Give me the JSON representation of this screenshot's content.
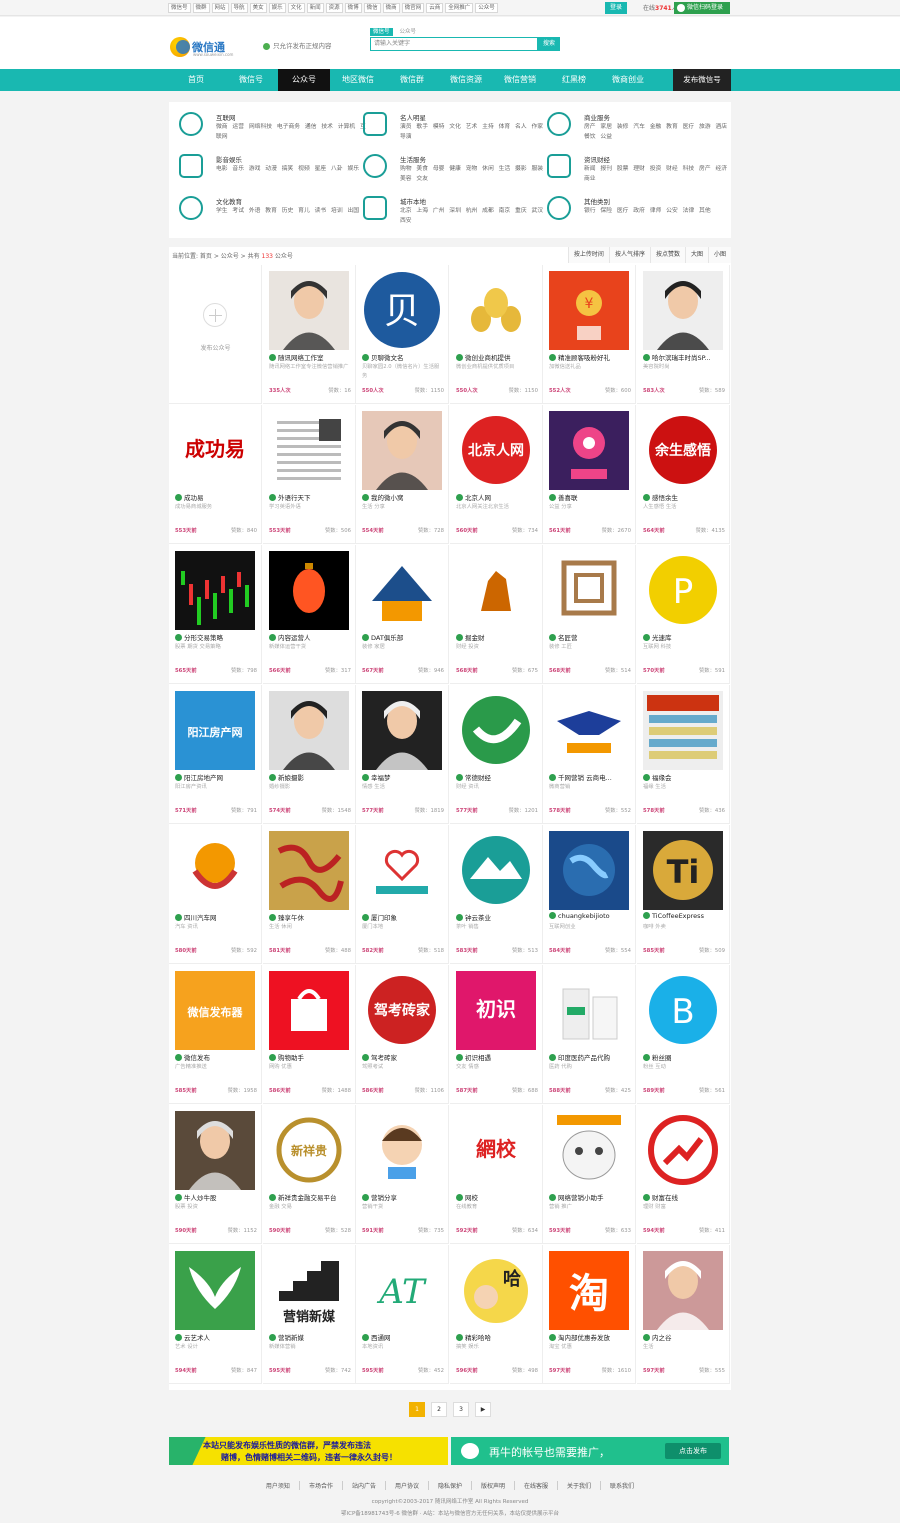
{
  "top_links": [
    "微信号",
    "微群",
    "网站",
    "导航",
    "美女",
    "娱乐",
    "文化",
    "新闻",
    "资源",
    "微博",
    "微信",
    "微商",
    "微官网",
    "云商",
    "全网推广",
    "公众号"
  ],
  "login_label": "登录",
  "online": {
    "prefix": "在线",
    "count": "3741",
    "suffix": "人"
  },
  "wx_login_label": "微信扫码登录",
  "logo": {
    "name": "微信通",
    "sub": "www.souweixin.com"
  },
  "slogan": "只允许发布正规内容",
  "search": {
    "tabs": [
      "微信号",
      "公众号"
    ],
    "placeholder": "请输入关键字",
    "button": "搜索"
  },
  "nav": {
    "items": [
      "首页",
      "微信号",
      "公众号",
      "地区微信",
      "微信群",
      "微信资源",
      "微信营销",
      "红黑榜",
      "微商创业"
    ],
    "publish": "发布微信号"
  },
  "categories": [
    {
      "icon": "globe-icon",
      "title": "互联网",
      "links": "微商 运营 网络科技 电子商务 通信 技术 计算机 互联网"
    },
    {
      "icon": "person-icon",
      "title": "名人明星",
      "links": "演员 歌手 模特 文化 艺术 主持 体育 名人 作家 导演"
    },
    {
      "icon": "shop-icon",
      "title": "商业服务",
      "links": "房产 家居 装修 汽车 金融 教育 医疗 旅游 酒店 餐饮 公益"
    },
    {
      "icon": "film-icon",
      "title": "影音娱乐",
      "links": "电影 音乐 游戏 动漫 搞笑 视频 星座 八卦 娱乐"
    },
    {
      "icon": "cart-icon",
      "title": "生活服务",
      "links": "购物 美食 母婴 健康 宠物 休闲 生活 摄影 服装 美容 交友"
    },
    {
      "icon": "chart-icon",
      "title": "资讯财经",
      "links": "新闻 报刊 股票 理财 投资 财经 科技 房产 经济 商业"
    },
    {
      "icon": "book-icon",
      "title": "文化教育",
      "links": "学生 考试 外语 教育 历史 育儿 读书 培训 出国"
    },
    {
      "icon": "store-icon",
      "title": "城市本地",
      "links": "北京 上海 广州 深圳 杭州 成都 南京 重庆 武汉 西安"
    },
    {
      "icon": "chat-icon",
      "title": "其他类别",
      "links": "银行 保险 医疗 政府 律师 公安 法律 其他"
    }
  ],
  "breadcrumb": {
    "prefix": "当前位置: 首页 > 公众号 > 共有",
    "count": "133",
    "suffix": "公众号"
  },
  "sort_options": [
    "按上传时间",
    "按人气排序",
    "按点赞数",
    "大图",
    "小图"
  ],
  "add_card_label": "发布公众号",
  "cards": [
    {
      "name": "随讯网络工作室",
      "desc": "随讯网络工作室专注微信营销推广",
      "fans": "335人次",
      "likes": "赞数：16",
      "art": "girl",
      "bg": "#e9e4df",
      "fg": "#333"
    },
    {
      "name": "贝聊微文名",
      "desc": "贝聊家园2.0（微信名片）生活服务",
      "fans": "550人次",
      "likes": "赞数：1150",
      "art": "letter",
      "bg": "#1e5a9e",
      "fg": "#fff",
      "text": "贝"
    },
    {
      "name": "微创业商机提供",
      "desc": "微创业商机提供优质项目",
      "fans": "550人次",
      "likes": "赞数：1150",
      "art": "eggs",
      "bg": "#fff",
      "fg": "#c90"
    },
    {
      "name": "精准顾客吸粉好礼",
      "desc": "加微信送礼品",
      "fans": "552人次",
      "likes": "赞数：600",
      "art": "redpacket",
      "bg": "#e8431c",
      "fg": "#f5c342"
    },
    {
      "name": "哈尔滨瑞丰时尚SP...",
      "desc": "美容院时尚",
      "fans": "583人次",
      "likes": "赞数：589",
      "art": "woman",
      "bg": "#eee",
      "fg": "#222"
    },
    {
      "name": "成功易",
      "desc": "成功易商城服务",
      "fans": "553天前",
      "likes": "赞数：840",
      "art": "text",
      "bg": "#fff",
      "fg": "#c00",
      "text": "成功易"
    },
    {
      "name": "外语行天下",
      "desc": "学习英语外语",
      "fans": "553天前",
      "likes": "赞数：506",
      "art": "doc",
      "bg": "#fff",
      "fg": "#555"
    },
    {
      "name": "我的微小窝",
      "desc": "生活 分享",
      "fans": "554天前",
      "likes": "赞数：728",
      "art": "girl2",
      "bg": "#e6c8b8",
      "fg": "#333"
    },
    {
      "name": "北京人网",
      "desc": "北京人网关注北京生活",
      "fans": "560天前",
      "likes": "赞数：734",
      "art": "seal",
      "bg": "#fff",
      "fg": "#d22",
      "text": "北京人网"
    },
    {
      "name": "善喜联",
      "desc": "公益 分享",
      "fans": "561天前",
      "likes": "赞数：2670",
      "art": "flower",
      "bg": "#3b1f5e",
      "fg": "#e48"
    },
    {
      "name": "感悟余生",
      "desc": "人生感悟 生活",
      "fans": "564天前",
      "likes": "赞数：4135",
      "art": "seal2",
      "bg": "#fff",
      "fg": "#c11",
      "text": "余生感悟"
    },
    {
      "name": "分形交易策略",
      "desc": "股票 期货 交易策略",
      "fans": "565天前",
      "likes": "赞数：798",
      "art": "candles",
      "bg": "#111",
      "fg": "#2c2"
    },
    {
      "name": "内容运营人",
      "desc": "新媒体运营干货",
      "fans": "566天前",
      "likes": "赞数：317",
      "art": "lantern",
      "bg": "#000",
      "fg": "#f52"
    },
    {
      "name": "DAT俱乐部",
      "desc": "装修 家居",
      "fans": "567天前",
      "likes": "赞数：946",
      "art": "house",
      "bg": "#fff",
      "fg": "#1c4e8b"
    },
    {
      "name": "掘金财",
      "desc": "财经 投资",
      "fans": "568天前",
      "likes": "赞数：675",
      "art": "bull",
      "bg": "#fff",
      "fg": "#c60"
    },
    {
      "name": "名匠营",
      "desc": "装修 工匠",
      "fans": "568天前",
      "likes": "赞数：514",
      "art": "square",
      "bg": "#fff",
      "fg": "#a87a4a"
    },
    {
      "name": "光速库",
      "desc": "互联网 科技",
      "fans": "570天前",
      "likes": "赞数：591",
      "art": "blob",
      "bg": "#fff",
      "fg": "#f2cf00",
      "text": "P"
    },
    {
      "name": "阳江房地产网",
      "desc": "阳江房产资讯",
      "fans": "571天前",
      "likes": "赞数：791",
      "art": "bluetext",
      "bg": "#2a92d4",
      "fg": "#fff",
      "text": "阳江房产网"
    },
    {
      "name": "新娘摄影",
      "desc": "婚纱摄影",
      "fans": "574天前",
      "likes": "赞数：1548",
      "art": "woman2",
      "bg": "#ddd",
      "fg": "#222"
    },
    {
      "name": "幸福梦",
      "desc": "情感 生活",
      "fans": "577天前",
      "likes": "赞数：1819",
      "art": "woman3",
      "bg": "#222",
      "fg": "#eee"
    },
    {
      "name": "常德财经",
      "desc": "财经 资讯",
      "fans": "577天前",
      "likes": "赞数：1201",
      "art": "greenlogo",
      "bg": "#fff",
      "fg": "#2a9a4a"
    },
    {
      "name": "千网营销 云商电...",
      "desc": "微商营销",
      "fans": "578天前",
      "likes": "赞数：552",
      "art": "eagle",
      "bg": "#fff",
      "fg": "#1d3e9a"
    },
    {
      "name": "福缘会",
      "desc": "福缘 生活",
      "fans": "578天前",
      "likes": "赞数：436",
      "art": "poster",
      "bg": "#c31",
      "fg": "#fe6"
    },
    {
      "name": "四川汽车网",
      "desc": "汽车 资讯",
      "fans": "580天前",
      "likes": "赞数：592",
      "art": "emblem",
      "bg": "#fff",
      "fg": "#c33"
    },
    {
      "name": "臻享午休",
      "desc": "生活 休闲",
      "fans": "581天前",
      "likes": "赞数：488",
      "art": "calligraphy",
      "bg": "#c9a24a",
      "fg": "#b22"
    },
    {
      "name": "厦门印象",
      "desc": "厦门本地",
      "fans": "582天前",
      "likes": "赞数：518",
      "art": "heart",
      "bg": "#fff",
      "fg": "#2aa"
    },
    {
      "name": "钟云茶业",
      "desc": "茶叶 销售",
      "fans": "583天前",
      "likes": "赞数：513",
      "art": "mountain",
      "bg": "#fff",
      "fg": "#1a9e97"
    },
    {
      "name": "chuangkebijioto",
      "desc": "互联网创业",
      "fans": "584天前",
      "likes": "赞数：554",
      "art": "earth",
      "bg": "#1a4a8a",
      "fg": "#8cf"
    },
    {
      "name": "TiCoffeeExpress",
      "desc": "咖啡 外卖",
      "fans": "585天前",
      "likes": "赞数：509",
      "art": "ti",
      "bg": "#2a2a2a",
      "fg": "#d9a93a",
      "text": "Ti"
    },
    {
      "name": "微信发布",
      "desc": "广告精准推送",
      "fans": "585天前",
      "likes": "赞数：1958",
      "art": "orangetext",
      "bg": "#f6a21e",
      "fg": "#fff",
      "text": "微信发布器"
    },
    {
      "name": "购物助手",
      "desc": "网购 优惠",
      "fans": "586天前",
      "likes": "赞数：1488",
      "art": "bag",
      "bg": "#e12",
      "fg": "#fff"
    },
    {
      "name": "驾考砖家",
      "desc": "驾照考试",
      "fans": "586天前",
      "likes": "赞数：1106",
      "art": "stamp",
      "bg": "#fff",
      "fg": "#c22",
      "text": "驾考砖家"
    },
    {
      "name": "初识相遇",
      "desc": "交友 情感",
      "fans": "587天前",
      "likes": "赞数：688",
      "art": "pinktext",
      "bg": "#e0176b",
      "fg": "#fff",
      "text": "初识"
    },
    {
      "name": "印度医药产品代购",
      "desc": "医药 代购",
      "fans": "588天前",
      "likes": "赞数：425",
      "art": "bottle",
      "bg": "#fff",
      "fg": "#2a6"
    },
    {
      "name": "粉丝圈",
      "desc": "粉丝 互动",
      "fans": "589天前",
      "likes": "赞数：561",
      "art": "bblob",
      "bg": "#fff",
      "fg": "#1ab0e8",
      "text": "B"
    },
    {
      "name": "牛人炒牛股",
      "desc": "股票 投资",
      "fans": "590天前",
      "likes": "赞数：1152",
      "art": "warrior",
      "bg": "#5a4a3a",
      "fg": "#ddd"
    },
    {
      "name": "新祥贵金融交易平台",
      "desc": "金融 交易",
      "fans": "590天前",
      "likes": "赞数：528",
      "art": "ring",
      "bg": "#fff",
      "fg": "#b9902d",
      "text": "新祥贵"
    },
    {
      "name": "营销分享",
      "desc": "营销干货",
      "fans": "591天前",
      "likes": "赞数：735",
      "art": "cartoon",
      "bg": "#fff",
      "fg": "#333"
    },
    {
      "name": "网校",
      "desc": "在线教育",
      "fans": "592天前",
      "likes": "赞数：634",
      "art": "redtext",
      "bg": "#fff",
      "fg": "#d22",
      "text": "網校"
    },
    {
      "name": "网络营销小助手",
      "desc": "营销 推广",
      "fans": "593天前",
      "likes": "赞数：633",
      "art": "meme",
      "bg": "#fff",
      "fg": "#444"
    },
    {
      "name": "财富在线",
      "desc": "理财 财富",
      "fans": "594天前",
      "likes": "赞数：411",
      "art": "arrow",
      "bg": "#fff",
      "fg": "#d22"
    },
    {
      "name": "云艺术人",
      "desc": "艺术 设计",
      "fans": "594天前",
      "likes": "赞数：847",
      "art": "wings",
      "bg": "#3aa14a",
      "fg": "#fff"
    },
    {
      "name": "营销新媒",
      "desc": "新媒体营销",
      "fans": "595天前",
      "likes": "赞数：742",
      "art": "stairs",
      "bg": "#fff",
      "fg": "#222",
      "text": "营销新媒"
    },
    {
      "name": "西通网",
      "desc": "本地资讯",
      "fans": "595天前",
      "likes": "赞数：452",
      "art": "at",
      "bg": "#fff",
      "fg": "#2a7",
      "text": "AT"
    },
    {
      "name": "精彩哈哈",
      "desc": "搞笑 娱乐",
      "fans": "596天前",
      "likes": "赞数：498",
      "art": "anime",
      "bg": "#f5d74a",
      "fg": "#222",
      "text": "哈"
    },
    {
      "name": "淘内部优惠券发放",
      "desc": "淘宝 优惠",
      "fans": "597天前",
      "likes": "赞数：1610",
      "art": "tao",
      "bg": "#ff5000",
      "fg": "#fff",
      "text": "淘"
    },
    {
      "name": "内之谷",
      "desc": "生活",
      "fans": "597天前",
      "likes": "赞数：555",
      "art": "photo",
      "bg": "#c99",
      "fg": "#fff"
    }
  ],
  "pagination": [
    "1",
    "2",
    "3",
    "▶"
  ],
  "banner_left": {
    "line1": "本站只能发布娱乐性质的微信群，严禁发布违法",
    "line2": "赌博，色情赌博相关二维码，违者一律永久封号！"
  },
  "banner_right": {
    "text": "再牛的帐号也需要推广，",
    "button": "点击发布"
  },
  "footer_links": [
    "用户须知",
    "市场合作",
    "站内广告",
    "用户协议",
    "隐私保护",
    "版权声明",
    "在线客服",
    "关于我们",
    "联系我们"
  ],
  "copyright": "copyright©2003-2017 随讯网络工作室 All Rights Reserved",
  "icp": "鄂ICP备18981743号-6 微信群 · A站：本站与微信官方无任何关系，本站仅提供展示平台"
}
